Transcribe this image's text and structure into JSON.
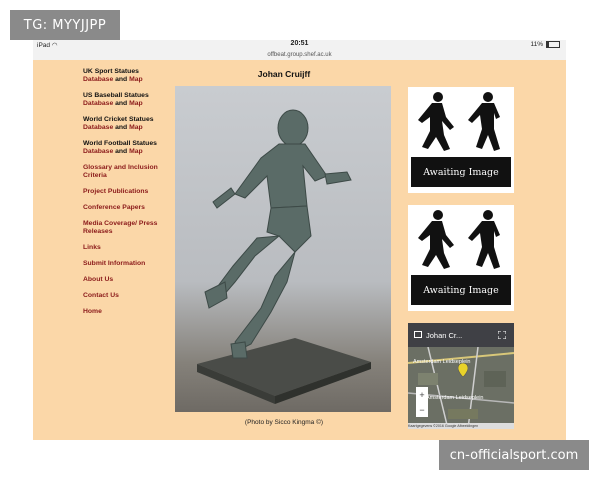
{
  "watermark_top": "TG: MYYJJPP",
  "watermark_bottom": "cn-officialsport.com",
  "status_bar": {
    "device": "iPad",
    "time": "20:51",
    "battery": "11%"
  },
  "url": "offbeat.group.shef.ac.uk",
  "sidebar": {
    "items": [
      {
        "title": "UK Sport Statues",
        "sub_a": "Database",
        "sub_and": " and ",
        "sub_b": "Map"
      },
      {
        "title": "US Baseball Statues",
        "sub_a": "Database",
        "sub_and": " and ",
        "sub_b": "Map"
      },
      {
        "title": "World Cricket Statues",
        "sub_a": "Database",
        "sub_and": " and ",
        "sub_b": "Map"
      },
      {
        "title": "World Football Statues",
        "sub_a": "Database",
        "sub_and": " and ",
        "sub_b": "Map"
      },
      {
        "title": "Glossary and Inclusion Criteria"
      },
      {
        "title": "Project Publications"
      },
      {
        "title": "Conference Papers"
      },
      {
        "title": "Media Coverage/ Press Releases"
      },
      {
        "title": "Links"
      },
      {
        "title": "Submit Information"
      },
      {
        "title": "About Us"
      },
      {
        "title": "Contact Us"
      },
      {
        "title": "Home"
      }
    ]
  },
  "main": {
    "title": "Johan Cruijff",
    "caption": "(Photo by Sicco Kingma ©)"
  },
  "right": {
    "awaiting_label": "Awaiting Image",
    "map_title": "Johan Cr...",
    "map_labels": [
      "Amsterdam Leidseplein",
      "Amsterdam Leidseplein"
    ],
    "zoom_in": "+",
    "zoom_out": "−",
    "attribution": "Kaartgegevens ©2016 Google Afbeeldingen"
  }
}
